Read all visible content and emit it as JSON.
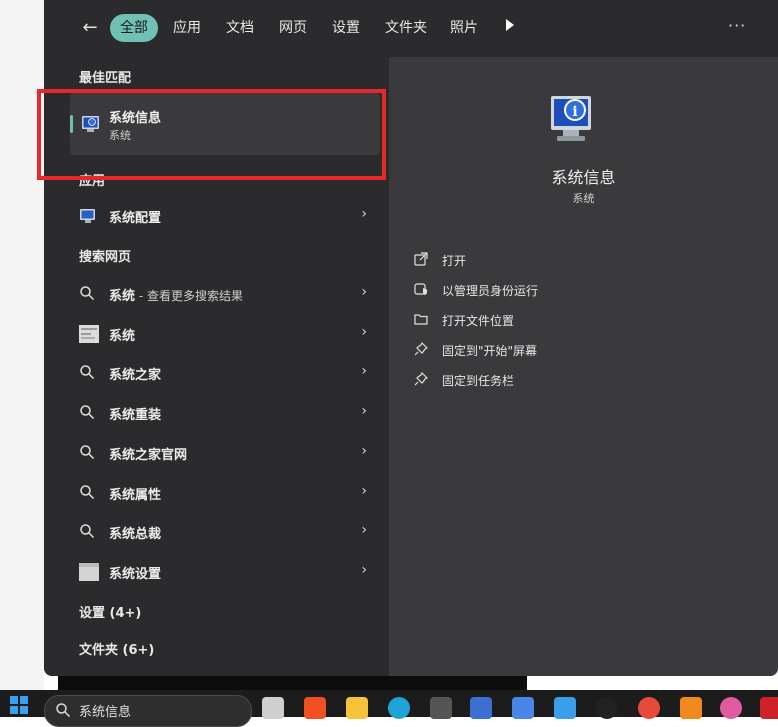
{
  "topbar": {
    "tabs": [
      {
        "label": "全部",
        "active": true
      },
      {
        "label": "应用"
      },
      {
        "label": "文档"
      },
      {
        "label": "网页"
      },
      {
        "label": "设置"
      },
      {
        "label": "文件夹"
      },
      {
        "label": "照片"
      }
    ],
    "more_label": "···"
  },
  "sections": {
    "best_match": "最佳匹配",
    "apps": "应用",
    "web_search": "搜索网页",
    "settings": "设置 (4+)",
    "folders": "文件夹 (6+)"
  },
  "best_match": {
    "title": "系统信息",
    "subtitle": "系统"
  },
  "apps": [
    {
      "label": "系统配置"
    }
  ],
  "web_results": [
    {
      "label": "系统",
      "sub": " - 查看更多搜索结果",
      "icon": "search-icon"
    },
    {
      "label": "系统",
      "icon": "thumbnail-icon"
    },
    {
      "label": "系统之家",
      "icon": "search-icon"
    },
    {
      "label": "系统重装",
      "icon": "search-icon"
    },
    {
      "label": "系统之家官网",
      "icon": "search-icon"
    },
    {
      "label": "系统属性",
      "icon": "search-icon"
    },
    {
      "label": "系统总裁",
      "icon": "search-icon"
    },
    {
      "label": "系统设置",
      "icon": "thumbnail-icon"
    }
  ],
  "detail": {
    "title": "系统信息",
    "subtitle": "系统",
    "actions": [
      {
        "label": "打开",
        "icon": "open-icon"
      },
      {
        "label": "以管理员身份运行",
        "icon": "shield-icon"
      },
      {
        "label": "打开文件位置",
        "icon": "folder-icon"
      },
      {
        "label": "固定到\"开始\"屏幕",
        "icon": "pin-icon"
      },
      {
        "label": "固定到任务栏",
        "icon": "pin-icon"
      }
    ]
  },
  "taskbar": {
    "search_value": "系统信息"
  },
  "colors": {
    "accent": "#6fc2b3",
    "highlight_box": "#e4282c",
    "panel": "#2b2b2e",
    "detail_panel": "#3a3a3d"
  }
}
